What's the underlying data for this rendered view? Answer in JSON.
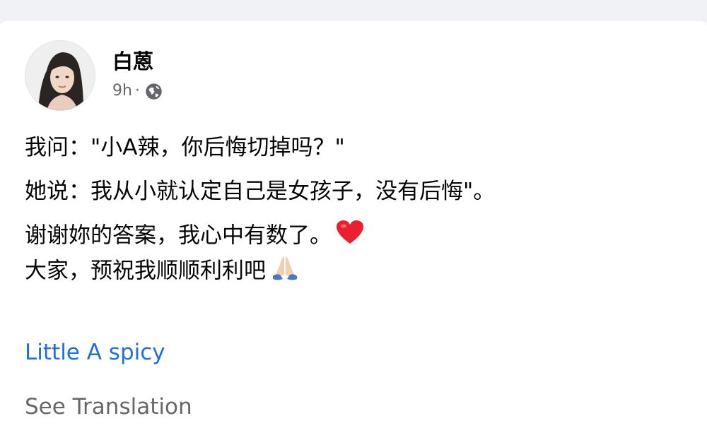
{
  "post": {
    "author": "白蒽",
    "time": "9h",
    "separator": "·",
    "privacy_icon": "globe-icon",
    "text_lines": [
      "我问：\"小A辣，你后悔切掉吗？\"",
      "她说：我从小就认定自己是女孩子，没有后悔\"。",
      "谢谢妳的答案，我心中有数了。",
      "大家，预祝我顺顺利利吧"
    ],
    "emojis": [
      "heart-icon",
      "praying-hands-icon"
    ],
    "link_text": "Little A spicy",
    "translate_label": "See Translation"
  },
  "colors": {
    "link": "#216fdb",
    "secondary_text": "#65676b",
    "primary_text": "#050505",
    "heart": "#e8202f"
  }
}
